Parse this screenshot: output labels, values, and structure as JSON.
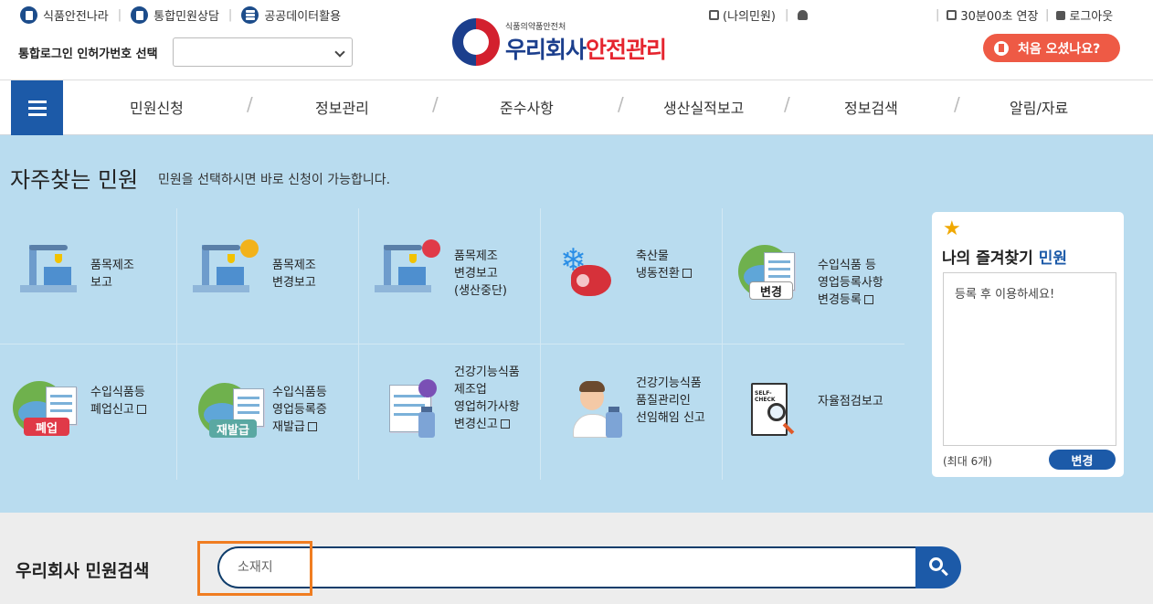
{
  "header": {
    "top_links": [
      {
        "label": "식품안전나라",
        "icon": "document-icon"
      },
      {
        "label": "통합민원상담",
        "icon": "document-icon"
      },
      {
        "label": "공공데이터활용",
        "icon": "list-icon"
      }
    ],
    "login_label": "통합로그인 인허가번호 선택",
    "login_select_value": "",
    "logo_small": "식품의약품안전처",
    "logo_main_a": "우리회사",
    "logo_main_b": "안전관리",
    "my_request": "(나의민원)",
    "session_extend": "30분00초 연장",
    "logout": "로그아웃",
    "first_visit": "처음 오셨나요?"
  },
  "gnb": [
    "민원신청",
    "정보관리",
    "준수사항",
    "생산실적보고",
    "정보검색",
    "알림/자료"
  ],
  "favorites": {
    "title": "자주찾는 민원",
    "subtitle": "민원을 선택하시면 바로 신청이 가능합니다.",
    "items": [
      {
        "lines": [
          "품목제조",
          "보고"
        ],
        "external": false
      },
      {
        "lines": [
          "품목제조",
          "변경보고"
        ],
        "external": false
      },
      {
        "lines": [
          "품목제조",
          "변경보고",
          "(생산중단)"
        ],
        "external": false
      },
      {
        "lines": [
          "축산물",
          "냉동전환"
        ],
        "external": true
      },
      {
        "lines": [
          "수입식품 등",
          "영업등록사항",
          "변경등록"
        ],
        "external": true,
        "tag": "변경"
      },
      {
        "lines": [
          "수입식품등",
          "폐업신고"
        ],
        "external": true,
        "tag": "폐업"
      },
      {
        "lines": [
          "수입식품등",
          "영업등록증",
          "재발급"
        ],
        "external": true,
        "tag": "재발급"
      },
      {
        "lines": [
          "건강기능식품",
          "제조업",
          "영업허가사항",
          "변경신고"
        ],
        "external": true
      },
      {
        "lines": [
          "건강기능식품",
          "품질관리인",
          "선임해임 신고"
        ],
        "external": false
      },
      {
        "lines": [
          "자율점검보고"
        ],
        "external": false,
        "icon_text": "SELF-CHECK"
      }
    ]
  },
  "my_favorites": {
    "title_a": "나의 즐겨찾기",
    "title_b": "민원",
    "placeholder": "등록 후 이용하세요!",
    "max": "(최대 6개)",
    "change": "변경"
  },
  "search": {
    "title": "우리회사 민원검색",
    "placeholder": "소재지",
    "value": ""
  },
  "colors": {
    "primary": "#1c5aa8",
    "fav_bg": "#b9dcef",
    "accent": "#ee5a45",
    "highlight": "#f07d21"
  }
}
